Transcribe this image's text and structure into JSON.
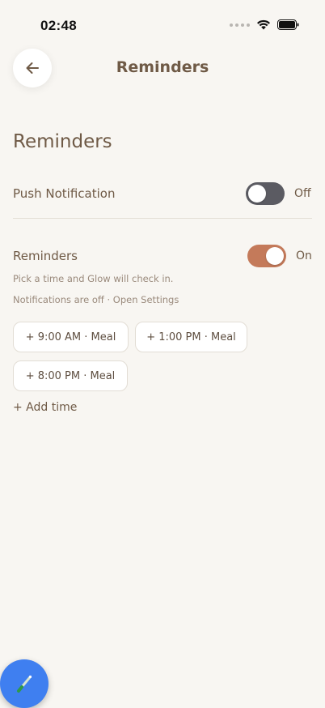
{
  "status_bar": {
    "time": "02:48"
  },
  "header": {
    "title": "Reminders"
  },
  "section": {
    "title": "Reminders"
  },
  "push_notification": {
    "label": "Push Notification",
    "state": "Off",
    "enabled": false
  },
  "reminders": {
    "label": "Reminders",
    "state": "On",
    "enabled": true,
    "hint": "Pick a time and Glow will check in.",
    "notifications_status": "Notifications are off · Open Settings",
    "times": [
      {
        "label": "+ 9:00 AM · Meal"
      },
      {
        "label": "+ 1:00 PM · Meal"
      },
      {
        "label": "+ 8:00 PM · Meal"
      }
    ],
    "add_time_label": "+ Add time"
  },
  "colors": {
    "background": "#f8f6f2",
    "text": "#6f5a46",
    "toggle_on": "#c47a5a",
    "toggle_off": "#5b5b62",
    "fab": "#3f7ff0"
  },
  "icons": {
    "back": "arrow-left-icon",
    "fab": "brush-icon",
    "wifi": "wifi-icon",
    "battery": "battery-icon",
    "signal": "signal-icon"
  }
}
